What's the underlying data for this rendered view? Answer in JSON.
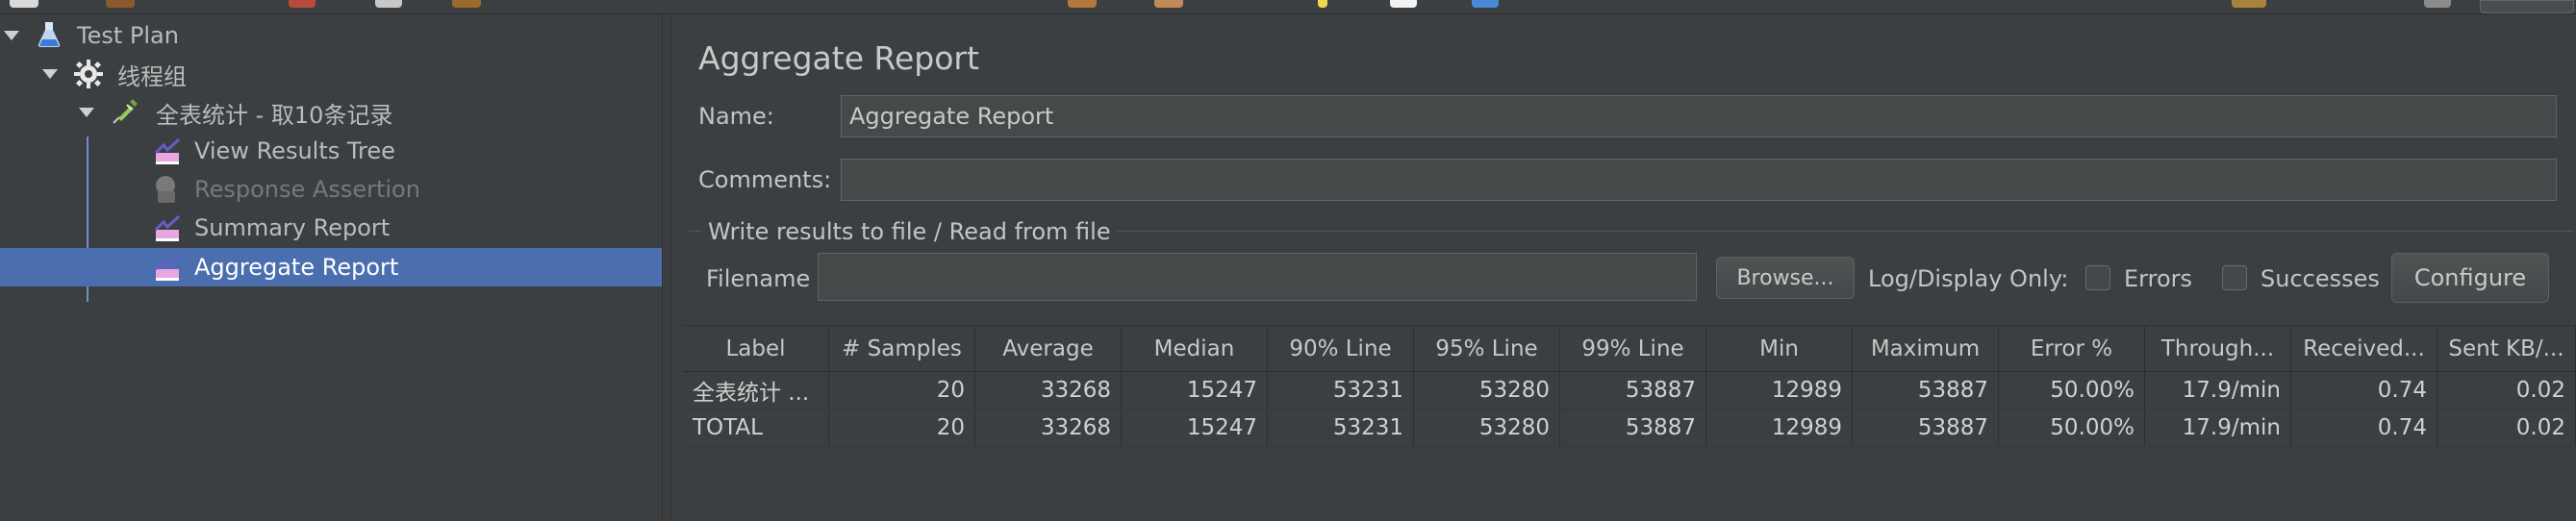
{
  "tree": {
    "items": [
      {
        "label": "Test Plan",
        "icon": "test-plan-icon",
        "expanded": true,
        "state": "normal"
      },
      {
        "label": "线程组",
        "icon": "thread-group-icon",
        "expanded": true,
        "state": "normal"
      },
      {
        "label": "全表统计 - 取10条记录",
        "icon": "sampler-icon",
        "expanded": true,
        "state": "normal"
      },
      {
        "label": "View Results Tree",
        "icon": "listener-icon",
        "state": "normal"
      },
      {
        "label": "Response Assertion",
        "icon": "assertion-icon",
        "state": "disabled"
      },
      {
        "label": "Summary Report",
        "icon": "listener-icon",
        "state": "normal"
      },
      {
        "label": "Aggregate Report",
        "icon": "listener-icon",
        "state": "selected"
      }
    ]
  },
  "panel": {
    "title": "Aggregate Report",
    "name_label": "Name:",
    "name_value": "Aggregate Report",
    "comments_label": "Comments:",
    "comments_value": "",
    "file_section_title": "Write results to file / Read from file",
    "filename_label": "Filename",
    "filename_value": "",
    "browse_label": "Browse...",
    "log_display_label": "Log/Display Only:",
    "errors_label": "Errors",
    "errors_checked": false,
    "successes_label": "Successes",
    "successes_checked": false,
    "configure_label": "Configure"
  },
  "table": {
    "headers": [
      "Label",
      "# Samples",
      "Average",
      "Median",
      "90% Line",
      "95% Line",
      "99% Line",
      "Min",
      "Maximum",
      "Error %",
      "Through...",
      "Received...",
      "Sent KB/..."
    ],
    "rows": [
      [
        "全表统计 ...",
        "20",
        "33268",
        "15247",
        "53231",
        "53280",
        "53887",
        "12989",
        "53887",
        "50.00%",
        "17.9/min",
        "0.74",
        "0.02"
      ],
      [
        "TOTAL",
        "20",
        "33268",
        "15247",
        "53231",
        "53280",
        "53887",
        "12989",
        "53887",
        "50.00%",
        "17.9/min",
        "0.74",
        "0.02"
      ]
    ]
  },
  "colors": {
    "background": "#3c3f41",
    "selection": "#4b6eaf",
    "text": "#bbbbbb",
    "disabled_text": "#787878"
  }
}
